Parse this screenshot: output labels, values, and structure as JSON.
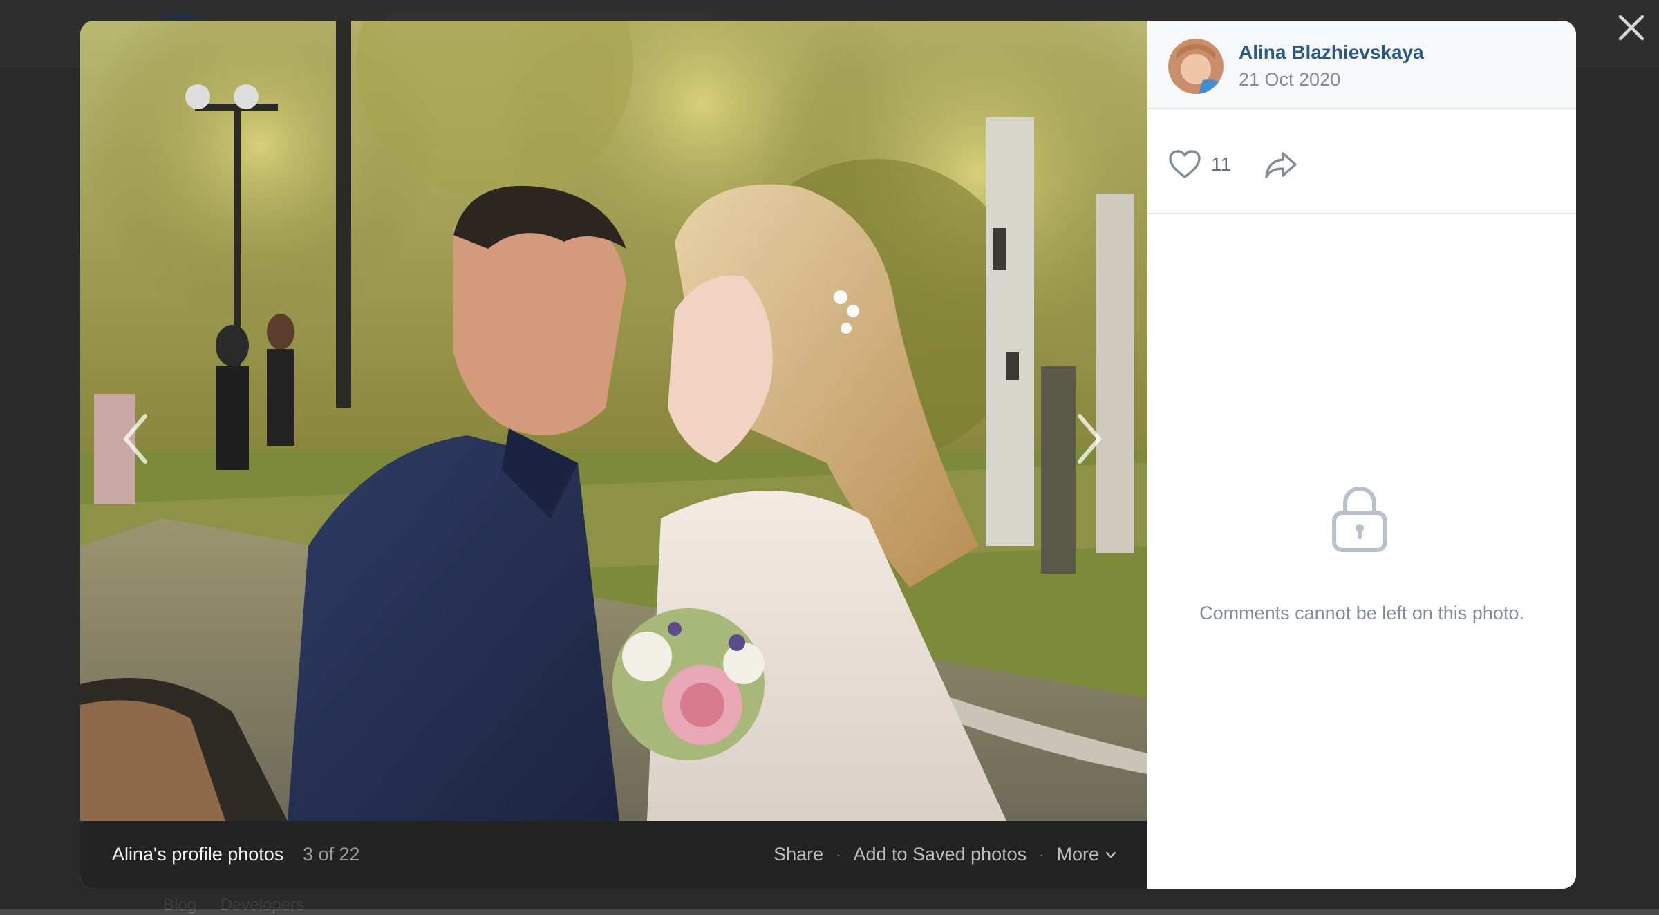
{
  "background_footer": {
    "links": [
      "Blog",
      "Developers"
    ]
  },
  "viewer": {
    "close_icon": "close-icon",
    "prev_icon": "chevron-left-icon",
    "next_icon": "chevron-right-icon",
    "footer": {
      "album_title": "Alina's profile photos",
      "counter": "3 of 22",
      "share_label": "Share",
      "separator": "·",
      "save_label": "Add to Saved photos",
      "more_label": "More"
    },
    "sidebar": {
      "author_name": "Alina Blazhievskaya",
      "date": "21 Oct 2020",
      "like_count": "11",
      "like_icon": "heart-icon",
      "share_icon": "share-arrow-icon",
      "lock_icon": "lock-icon",
      "comments_note": "Comments cannot be left on this photo."
    }
  },
  "colors": {
    "link": "#2a5885",
    "muted": "#818c99",
    "footer_bg": "#232323"
  }
}
